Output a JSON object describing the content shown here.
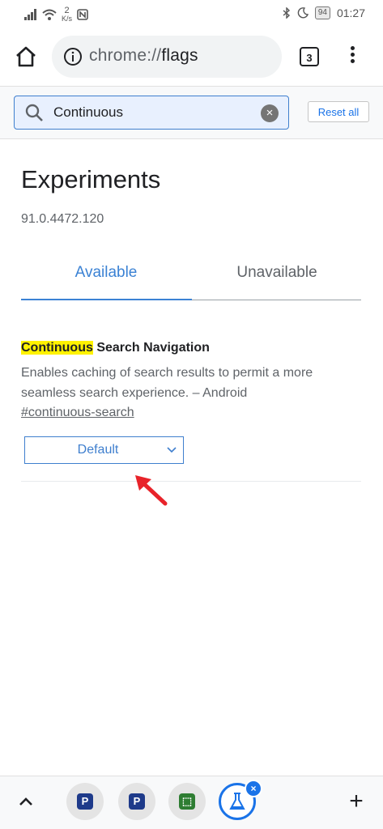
{
  "status_bar": {
    "network_speed": "2",
    "network_unit": "K/s",
    "battery": "94",
    "time": "01:27",
    "icons": [
      "signal-icon",
      "wifi-icon",
      "nfc-icon",
      "bluetooth-icon",
      "moon-icon",
      "battery-icon"
    ]
  },
  "toolbar": {
    "url_scheme": "chrome://",
    "url_host": "flags",
    "tab_count": "3",
    "icons": [
      "home-icon",
      "info-icon",
      "tab-switcher-icon",
      "overflow-menu-icon"
    ]
  },
  "search": {
    "value": "Continuous",
    "reset_label": "Reset all",
    "accent": "#3f7fce"
  },
  "page": {
    "title": "Experiments",
    "version": "91.0.4472.120",
    "tabs": [
      {
        "label": "Available",
        "active": true
      },
      {
        "label": "Unavailable",
        "active": false
      }
    ]
  },
  "flag": {
    "name_highlight": "Continuous",
    "name_rest": " Search Navigation",
    "description": "Enables caching of search results to permit a more seamless search experience. – Android",
    "link": "#continuous-search",
    "selected_option": "Default",
    "highlight_color": "#fff200"
  },
  "bottom_bar": {
    "tabs": [
      {
        "glyph": "P",
        "color": "#1e3a8a"
      },
      {
        "glyph": "P",
        "color": "#1e3a8a"
      },
      {
        "glyph": "⬚",
        "color": "#2e7d32"
      }
    ],
    "active_tab_icon": "flask-icon",
    "close_icon": "close-icon",
    "new_tab_label": "+"
  }
}
